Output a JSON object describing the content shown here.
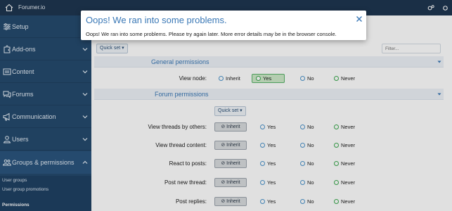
{
  "topbar": {
    "site_name": "Forumer.io",
    "icons": [
      "home-icon",
      "settings-icon",
      "extra-icon"
    ]
  },
  "sidebar": {
    "items": [
      {
        "label": "Setup",
        "icon": "sliders-icon"
      },
      {
        "label": "Add-ons",
        "icon": "puzzle-icon"
      },
      {
        "label": "Content",
        "icon": "content-icon"
      },
      {
        "label": "Forums",
        "icon": "comments-icon"
      },
      {
        "label": "Communication",
        "icon": "megaphone-icon"
      },
      {
        "label": "Users",
        "icon": "user-icon"
      },
      {
        "label": "Groups & permissions",
        "icon": "users-icon"
      }
    ],
    "subitems": [
      "User groups",
      "User group promotions",
      "Permissions"
    ]
  },
  "main": {
    "quick_set_label": "Quick set ▾",
    "filter_placeholder": "Filter...",
    "general_title": "General permissions",
    "forum_title": "Forum permissions",
    "view_node_label": "View node:",
    "options": {
      "inherit": "Inherit",
      "yes": "Yes",
      "no": "No",
      "never": "Never"
    },
    "forum_rows": [
      "View threads by others:",
      "View thread content:",
      "React to posts:",
      "Post new thread:",
      "Post replies:"
    ]
  },
  "modal": {
    "title": "Oops! We ran into some problems.",
    "message": "Oops! We ran into some problems. Please try again later. More error details may be in the browser console."
  },
  "colors": {
    "sidebar": "#254a6e",
    "topbar": "#1e3650",
    "accent": "#3a78b6",
    "yes_green": "#cdeac9"
  }
}
